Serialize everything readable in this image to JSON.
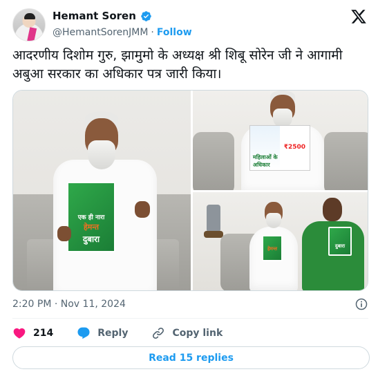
{
  "author": {
    "display_name": "Hemant Soren",
    "handle": "@HemantSorenJMM",
    "separator": "·",
    "follow_label": "Follow",
    "verified": true
  },
  "tweet": {
    "text": "आदरणीय दिशोम गुरु, झामुमो के अध्यक्ष श्री शिबू सोरेन जी ने आगामी अबुआ सरकार का अधिकार पत्र जारी किया।",
    "timestamp": "2:20 PM · Nov 11, 2024"
  },
  "media": {
    "photo1_book": {
      "line1": "एक ही नारा",
      "line2": "हेमन्त",
      "line3": "दुबारा"
    },
    "photo2_magazine": {
      "left": "महिलाओं के अधिकार",
      "right": "₹2500"
    },
    "photo3_books": {
      "a": "हेमन्त",
      "b": "दुबारा"
    }
  },
  "actions": {
    "like_count": "214",
    "reply_label": "Reply",
    "copy_link_label": "Copy link"
  },
  "read_replies_label": "Read 15 replies",
  "colors": {
    "accent": "#1d9bf0",
    "like": "#f91880",
    "text_secondary": "#536471"
  },
  "icons": [
    "x-logo-icon",
    "verified-badge-icon",
    "info-icon",
    "heart-icon",
    "reply-bubble-icon",
    "link-icon"
  ]
}
